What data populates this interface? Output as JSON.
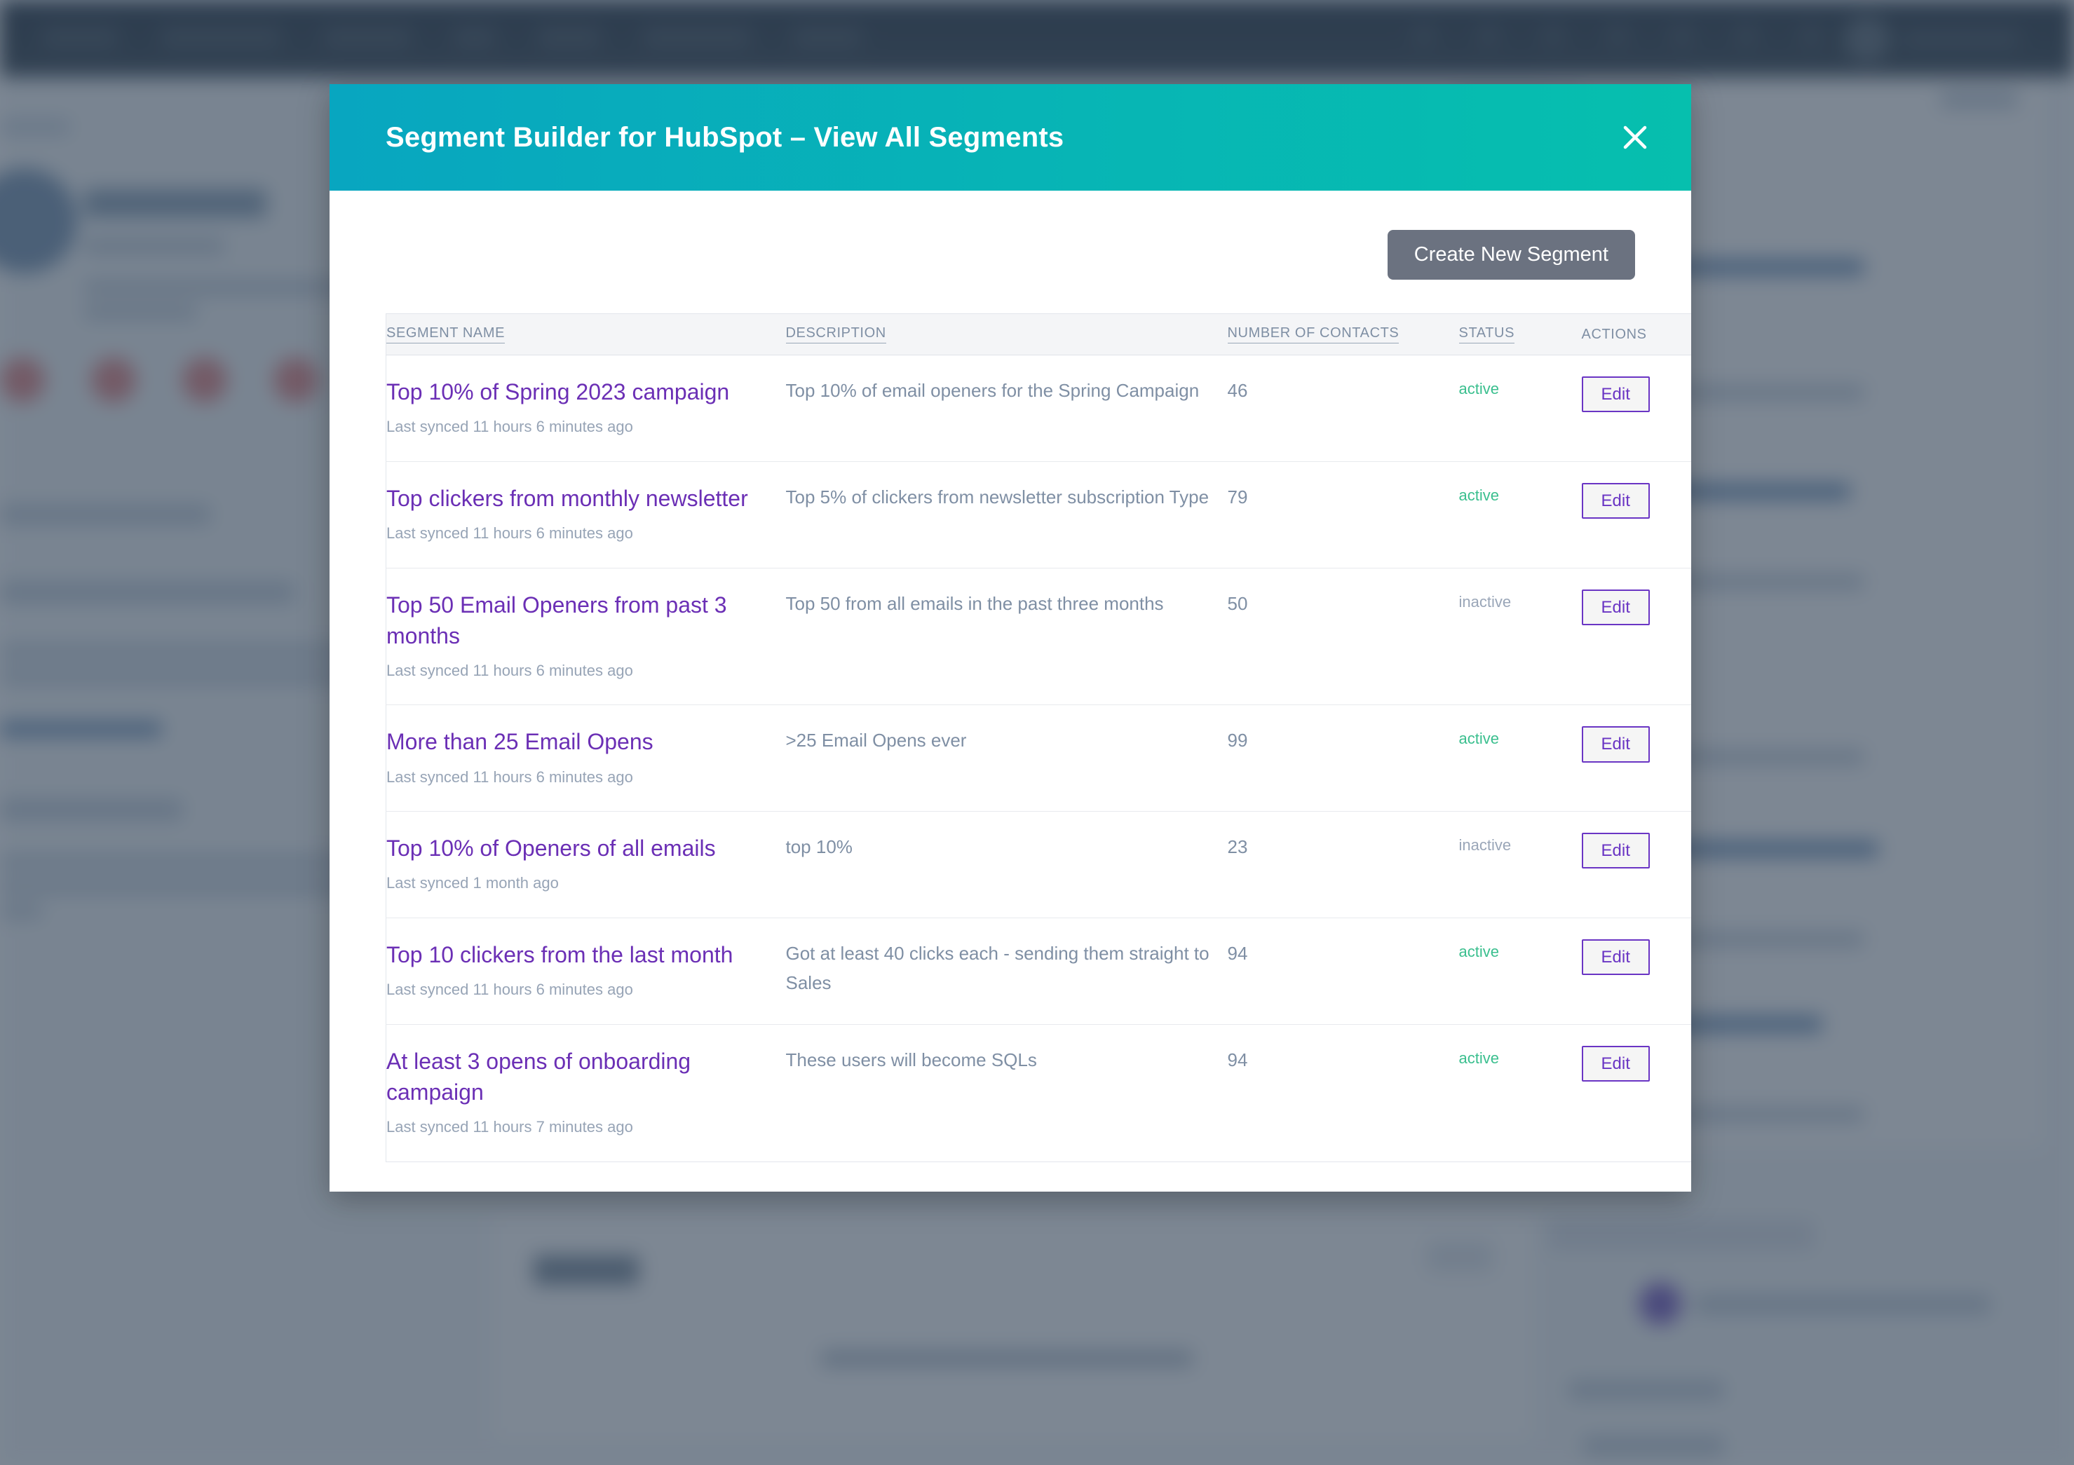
{
  "modal": {
    "title": "Segment Builder for HubSpot – View All Segments",
    "close_icon": "close-icon",
    "header_gradient_start": "#08A6C0",
    "header_gradient_end": "#06BFAE",
    "create_button_label": "Create New Segment",
    "create_button_color": "#6b7280"
  },
  "table": {
    "headers": {
      "name": "SEGMENT NAME",
      "description": "DESCRIPTION",
      "contacts": "NUMBER OF CONTACTS",
      "status": "STATUS",
      "actions": "ACTIONS"
    },
    "edit_label": "Edit",
    "colors": {
      "link": "#6b2fb5",
      "active": "#3abf8e",
      "inactive": "#9aa6b8",
      "edit_border": "#6a35c4"
    },
    "rows": [
      {
        "name": "Top 10% of Spring 2023 campaign",
        "synced": "Last synced 11 hours 6 minutes ago",
        "description": "Top 10% of email openers for the Spring Campaign",
        "contacts": "46",
        "status": "active"
      },
      {
        "name": "Top clickers from monthly newsletter",
        "synced": "Last synced 11 hours 6 minutes ago",
        "description": "Top 5% of clickers from newsletter subscription Type",
        "contacts": "79",
        "status": "active"
      },
      {
        "name": "Top 50 Email Openers from past 3 months",
        "synced": "Last synced 11 hours 6 minutes ago",
        "description": "Top 50 from all emails in the past three months",
        "contacts": "50",
        "status": "inactive"
      },
      {
        "name": "More than 25 Email Opens",
        "synced": "Last synced 11 hours 6 minutes ago",
        "description": ">25 Email Opens ever",
        "contacts": "99",
        "status": "active"
      },
      {
        "name": "Top 10% of Openers of all emails",
        "synced": "Last synced 1 month ago",
        "description": "top 10%",
        "contacts": "23",
        "status": "inactive"
      },
      {
        "name": "Top 10 clickers from the last month",
        "synced": "Last synced 11 hours 6 minutes ago",
        "description": "Got at least 40 clicks each - sending them straight to Sales",
        "contacts": "94",
        "status": "active"
      },
      {
        "name": "At least 3 opens of onboarding campaign",
        "synced": "Last synced 11 hours 7 minutes ago",
        "description": "These users will become SQLs",
        "contacts": "94",
        "status": "active"
      }
    ]
  }
}
